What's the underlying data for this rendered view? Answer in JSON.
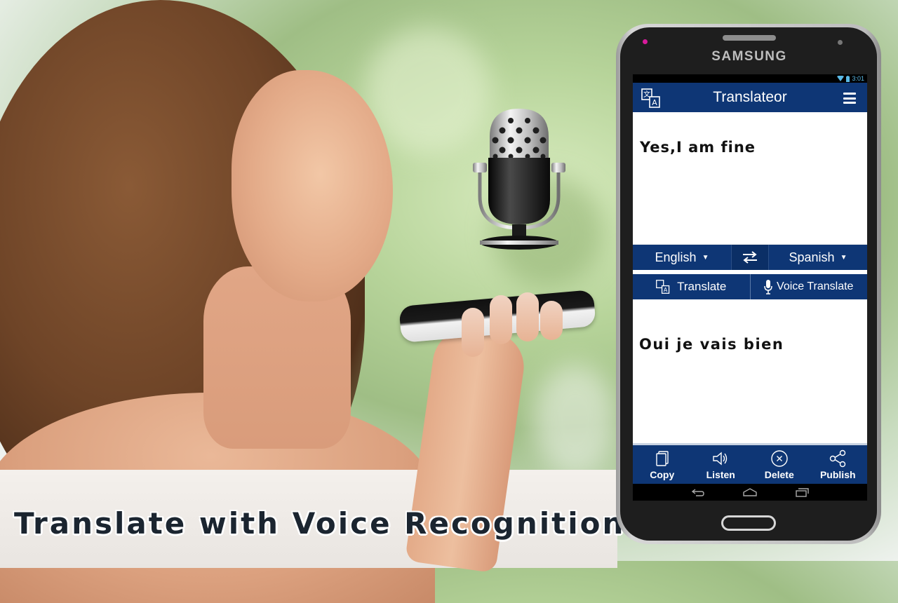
{
  "caption": "Translate with Voice Recognition",
  "phone": {
    "brand": "SAMSUNG",
    "status_bar": {
      "time": "3:01",
      "icons": [
        "wifi-icon",
        "battery-icon"
      ]
    },
    "app_bar": {
      "title": "Translateor",
      "left_icon": "translate-icon",
      "right_icon": "menu-icon"
    },
    "input_text": "Yes,I am fine",
    "languages": {
      "source": "English",
      "target": "Spanish",
      "swap_icon": "swap-arrows-icon"
    },
    "actions": [
      {
        "label": "Translate",
        "icon": "translate-icon"
      },
      {
        "label": "Voice Translate",
        "icon": "microphone-icon"
      }
    ],
    "output_text": "Oui je vais bien",
    "bottom_actions": [
      {
        "label": "Copy",
        "icon": "copy-icon"
      },
      {
        "label": "Listen",
        "icon": "speaker-icon"
      },
      {
        "label": "Delete",
        "icon": "delete-circle-icon"
      },
      {
        "label": "Publish",
        "icon": "share-icon"
      }
    ],
    "nav_buttons": [
      "back-icon",
      "home-icon",
      "recents-icon"
    ]
  },
  "colors": {
    "app_blue": "#0e3675",
    "accent_pink": "#d81b9c"
  }
}
